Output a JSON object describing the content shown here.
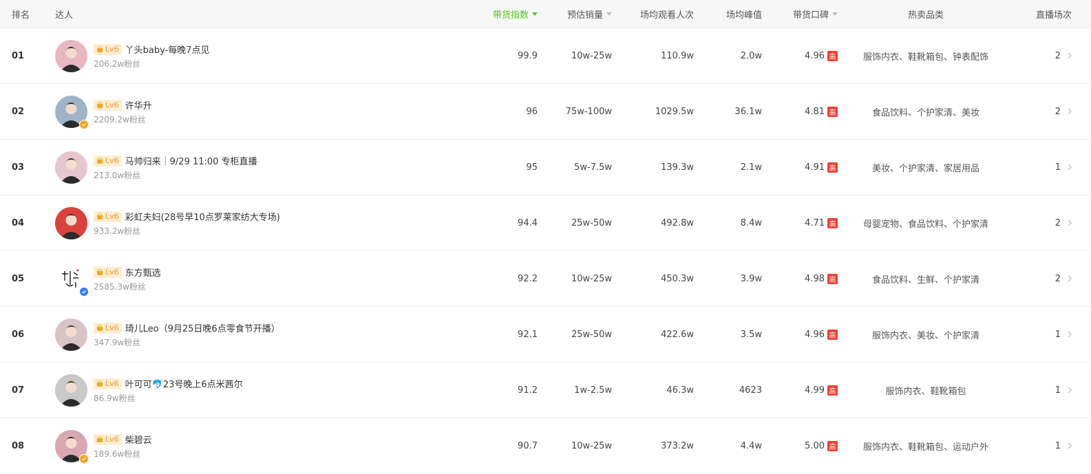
{
  "header": {
    "rank": "排名",
    "talent": "达人",
    "index": "带货指数",
    "sales": "预估销量",
    "views": "场均观看人次",
    "peak": "场均峰值",
    "reputation": "带货口碑",
    "category": "热卖品类",
    "sessions": "直播场次"
  },
  "colors": {
    "accent": "#52c41a",
    "badge_high": "#f04134",
    "level_bg": "#fdeed2",
    "level_text": "#f09a2b"
  },
  "rows": [
    {
      "rank": "01",
      "level": "Lv6",
      "name": "丫头baby-每晚7点见",
      "fans": "206.2w粉丝",
      "index": "99.9",
      "sales": "10w-25w",
      "views": "110.9w",
      "peak": "2.0w",
      "reputation": "4.96",
      "rep_badge": "高",
      "category": "服饰内衣、鞋靴箱包、钟表配饰",
      "sessions": "2",
      "avatar_icon": "avatar-portrait",
      "avatar_color": "#e8b7c2",
      "verified": ""
    },
    {
      "rank": "02",
      "level": "Lv6",
      "name": "许华升",
      "fans": "2209.2w粉丝",
      "index": "96",
      "sales": "75w-100w",
      "views": "1029.5w",
      "peak": "36.1w",
      "reputation": "4.81",
      "rep_badge": "高",
      "category": "食品饮料、个护家清、美妆",
      "sessions": "2",
      "avatar_icon": "avatar-portrait",
      "avatar_color": "#9fb4c8",
      "verified": "gold"
    },
    {
      "rank": "03",
      "level": "Lv6",
      "name": "马帅归来｜9/29 11:00 专柜直播",
      "fans": "213.0w粉丝",
      "index": "95",
      "sales": "5w-7.5w",
      "views": "139.3w",
      "peak": "2.1w",
      "reputation": "4.91",
      "rep_badge": "高",
      "category": "美妆、个护家清、家居用品",
      "sessions": "1",
      "avatar_icon": "avatar-portrait",
      "avatar_color": "#e6c6cf",
      "verified": ""
    },
    {
      "rank": "04",
      "level": "Lv6",
      "name": "彩虹夫妇(28号早10点罗莱家纺大专场)",
      "fans": "933.2w粉丝",
      "index": "94.4",
      "sales": "25w-50w",
      "views": "492.8w",
      "peak": "8.4w",
      "reputation": "4.71",
      "rep_badge": "高",
      "category": "母婴宠物、食品饮料、个护家清",
      "sessions": "2",
      "avatar_icon": "avatar-portrait",
      "avatar_color": "#d9423a",
      "verified": ""
    },
    {
      "rank": "05",
      "level": "Lv6",
      "name": "东方甄选",
      "fans": "2585.3w粉丝",
      "index": "92.2",
      "sales": "10w-25w",
      "views": "450.3w",
      "peak": "3.9w",
      "reputation": "4.98",
      "rep_badge": "高",
      "category": "食品饮料、生鲜、个护家清",
      "sessions": "2",
      "avatar_icon": "avatar-logo",
      "avatar_color": "#ffffff",
      "verified": "blue"
    },
    {
      "rank": "06",
      "level": "Lv6",
      "name": "琦儿Leo（9月25日晚6点零食节开播）",
      "fans": "347.9w粉丝",
      "index": "92.1",
      "sales": "25w-50w",
      "views": "422.6w",
      "peak": "3.5w",
      "reputation": "4.96",
      "rep_badge": "高",
      "category": "服饰内衣、美妆、个护家清",
      "sessions": "1",
      "avatar_icon": "avatar-portrait",
      "avatar_color": "#d8c4c6",
      "verified": ""
    },
    {
      "rank": "07",
      "level": "Lv6",
      "name": "叶可可🐬23号晚上6点米茜尔",
      "fans": "86.9w粉丝",
      "index": "91.2",
      "sales": "1w-2.5w",
      "views": "46.3w",
      "peak": "4623",
      "reputation": "4.99",
      "rep_badge": "高",
      "category": "服饰内衣、鞋靴箱包",
      "sessions": "1",
      "avatar_icon": "avatar-portrait",
      "avatar_color": "#c9c9c9",
      "verified": ""
    },
    {
      "rank": "08",
      "level": "Lv6",
      "name": "柴碧云",
      "fans": "189.6w粉丝",
      "index": "90.7",
      "sales": "10w-25w",
      "views": "373.2w",
      "peak": "4.4w",
      "reputation": "5.00",
      "rep_badge": "高",
      "category": "服饰内衣、鞋靴箱包、运动户外",
      "sessions": "1",
      "avatar_icon": "avatar-portrait",
      "avatar_color": "#d8a7b1",
      "verified": "gold"
    }
  ]
}
